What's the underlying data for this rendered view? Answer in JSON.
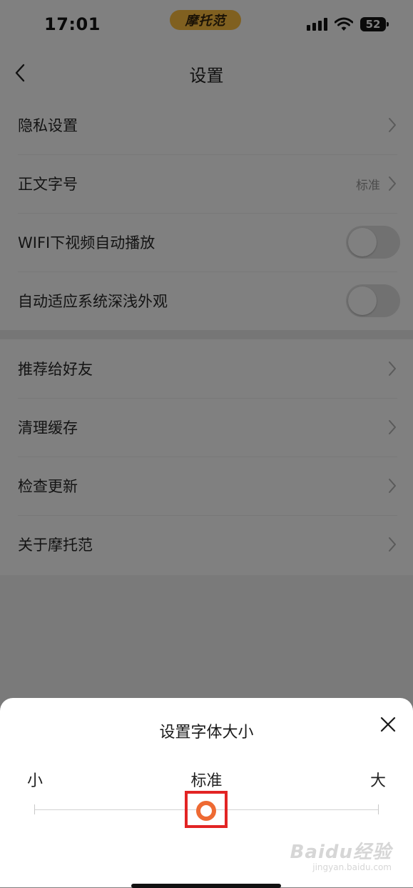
{
  "status_bar": {
    "time": "17:01",
    "app_badge": "摩托范",
    "battery": "52"
  },
  "nav": {
    "title": "设置"
  },
  "settings": {
    "group1": [
      {
        "label": "隐私设置",
        "type": "link"
      },
      {
        "label": "正文字号",
        "type": "link",
        "value": "标准"
      },
      {
        "label": "WIFI下视频自动播放",
        "type": "toggle",
        "on": false
      },
      {
        "label": "自动适应系统深浅外观",
        "type": "toggle",
        "on": false
      }
    ],
    "group2": [
      {
        "label": "推荐给好友",
        "type": "link"
      },
      {
        "label": "清理缓存",
        "type": "link"
      },
      {
        "label": "检查更新",
        "type": "link"
      },
      {
        "label": "关于摩托范",
        "type": "link"
      }
    ]
  },
  "font_sheet": {
    "title": "设置字体大小",
    "labels": {
      "small": "小",
      "standard": "标准",
      "large": "大"
    },
    "selected": "标准",
    "slider_position": 0.5
  },
  "watermark": {
    "main": "Baidu经验",
    "sub": "jingyan.baidu.com"
  },
  "colors": {
    "accent": "#ee6a33",
    "highlight_box": "#e22424",
    "overlay_dim": "#808080"
  }
}
